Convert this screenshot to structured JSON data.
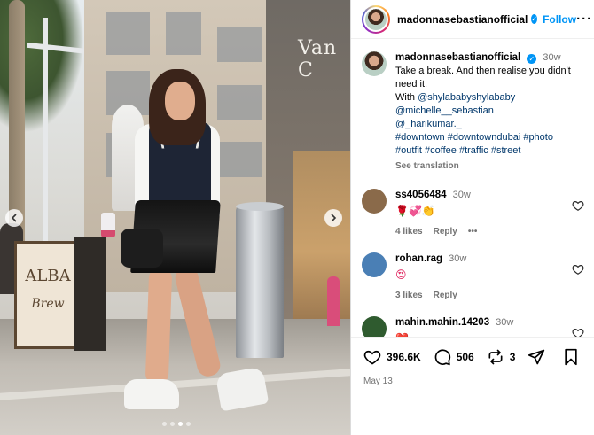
{
  "post": {
    "username": "madonnasebastianofficial",
    "follow_label": "Follow",
    "more_label": "···",
    "caption_time": "30w",
    "caption_line1": "Take a break. And then realise you didn't need it.",
    "caption_with": "With",
    "mentions": [
      "@shylababyshylababy",
      "@michelle__sebastian",
      "@_harikumar._"
    ],
    "hashtags_line1": "#downtown #downtowndubai #photo",
    "hashtags_line2": "#outfit #coffee #traffic #street",
    "see_translation": "See translation",
    "photo_sign_text": "ALBA",
    "photo_sign_script": "Brew",
    "photo_brand_text": "Van C",
    "carousel_dots": 4,
    "carousel_active_dot": 2
  },
  "comments": [
    {
      "user": "ss4056484",
      "time": "30w",
      "text": "🌹💞👏",
      "likes": "4 likes",
      "reply_label": "Reply",
      "more_label": "•••",
      "avatar_color": "#8a6a4a"
    },
    {
      "user": "rohan.rag",
      "time": "30w",
      "text": "😍",
      "likes": "3 likes",
      "reply_label": "Reply",
      "avatar_color": "#4a7fb5"
    },
    {
      "user": "mahin.mahin.14203",
      "time": "30w",
      "text": "❤️",
      "avatar_color": "#2f5b2f"
    }
  ],
  "actions": {
    "likes": "396.6K",
    "comments": "506",
    "reposts": "3",
    "date": "May 13"
  }
}
